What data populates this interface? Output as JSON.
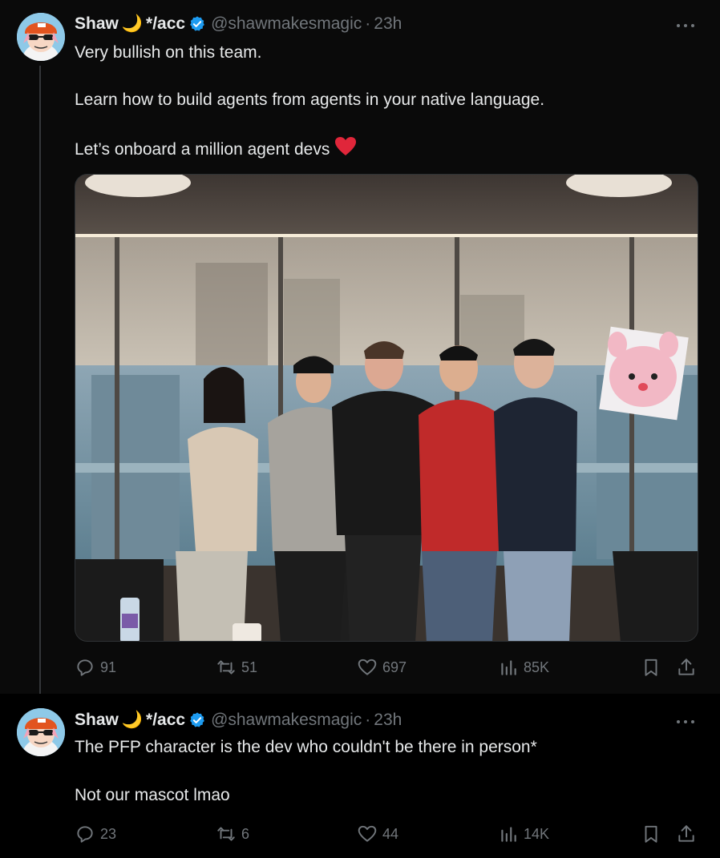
{
  "tweets": [
    {
      "author": {
        "name": "Shaw",
        "moon": "🌙",
        "name_suffix": "*/acc",
        "handle": "@shawmakesmagic",
        "dot": "·",
        "time": "23h",
        "avatar_icon": "anime-avatar-with-cap-and-sunglasses"
      },
      "lines": [
        "Very bullish on this team.",
        "Learn how to build agents from agents in your native language.",
        "Let’s onboard a million agent devs"
      ],
      "heart_emoji": "❤️",
      "stats": {
        "replies": "91",
        "reposts": "51",
        "likes": "697",
        "views": "85K"
      }
    },
    {
      "author": {
        "name": "Shaw",
        "moon": "🌙",
        "name_suffix": "*/acc",
        "handle": "@shawmakesmagic",
        "dot": "·",
        "time": "23h",
        "avatar_icon": "anime-avatar-with-cap-and-sunglasses"
      },
      "lines": [
        "The PFP character is the dev who couldn't be there in person*",
        "Not our mascot lmao"
      ],
      "stats": {
        "replies": "23",
        "reposts": "6",
        "likes": "44",
        "views": "14K"
      }
    }
  ],
  "colors": {
    "background": "#000000",
    "text": "#e7e9ea",
    "muted": "#71767b",
    "verified": "#1d9bf0"
  }
}
